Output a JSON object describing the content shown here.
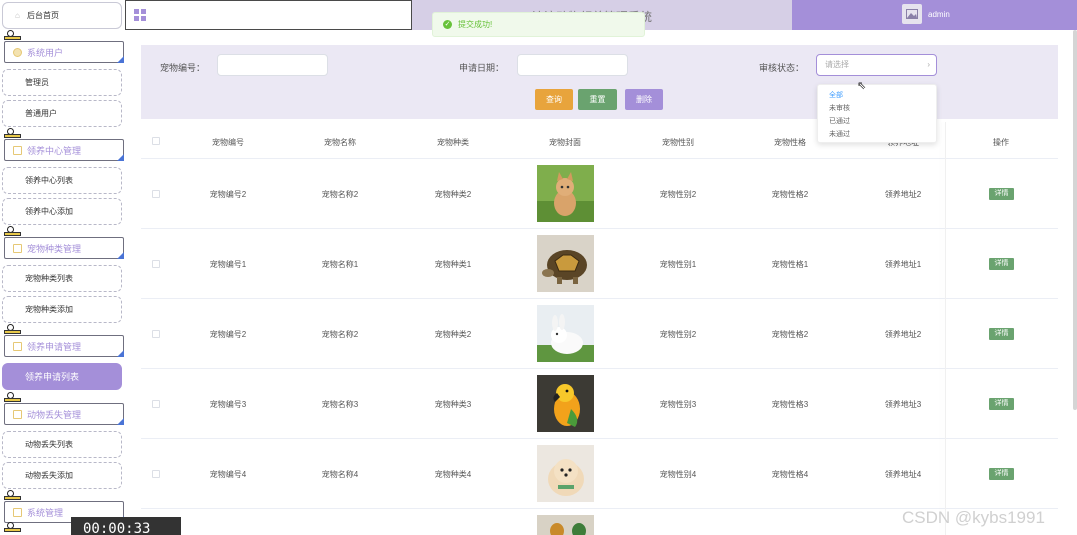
{
  "header": {
    "title": "流浪动物领养管理系统",
    "user": "admin"
  },
  "toast": {
    "message": "提交成功!"
  },
  "sidebar": {
    "home": "后台首页",
    "groups": [
      {
        "title": "系统用户",
        "items": [
          "管理员",
          "普通用户"
        ]
      },
      {
        "title": "领养中心管理",
        "items": [
          "领养中心列表",
          "领养中心添加"
        ]
      },
      {
        "title": "宠物种类管理",
        "items": [
          "宠物种类列表",
          "宠物种类添加"
        ]
      },
      {
        "title": "领养申请管理",
        "items": [
          "领养申请列表"
        ]
      },
      {
        "title": "动物丢失管理",
        "items": [
          "动物丢失列表",
          "动物丢失添加"
        ]
      },
      {
        "title": "系统管理",
        "items": []
      }
    ],
    "active_item": "领养申请列表"
  },
  "search": {
    "pet_no_label": "宠物编号：",
    "date_label": "申请日期：",
    "status_label": "审核状态：",
    "status_placeholder": "请选择",
    "status_options": [
      "全部",
      "未审核",
      "已通过",
      "未通过"
    ],
    "query": "查询",
    "reset": "重置",
    "delete": "删除"
  },
  "table": {
    "columns": [
      "宠物编号",
      "宠物名称",
      "宠物种类",
      "宠物封面",
      "宠物性别",
      "宠物性格",
      "领养地址",
      "操作"
    ],
    "detail_label": "详情",
    "rows": [
      {
        "no": "宠物编号2",
        "name": "宠物名称2",
        "kind": "宠物种类2",
        "cover": "kitten",
        "gender": "宠物性别2",
        "trait": "宠物性格2",
        "address": "领养地址2"
      },
      {
        "no": "宠物编号1",
        "name": "宠物名称1",
        "kind": "宠物种类1",
        "cover": "tortoise",
        "gender": "宠物性别1",
        "trait": "宠物性格1",
        "address": "领养地址1"
      },
      {
        "no": "宠物编号2",
        "name": "宠物名称2",
        "kind": "宠物种类2",
        "cover": "rabbit",
        "gender": "宠物性别2",
        "trait": "宠物性格2",
        "address": "领养地址2"
      },
      {
        "no": "宠物编号3",
        "name": "宠物名称3",
        "kind": "宠物种类3",
        "cover": "parrot",
        "gender": "宠物性别3",
        "trait": "宠物性格3",
        "address": "领养地址3"
      },
      {
        "no": "宠物编号4",
        "name": "宠物名称4",
        "kind": "宠物种类4",
        "cover": "pomeranian",
        "gender": "宠物性别4",
        "trait": "宠物性格4",
        "address": "领养地址4"
      }
    ]
  },
  "overlay": {
    "timer": "00:00:33",
    "watermark": "CSDN @kybs1991"
  },
  "colors": {
    "accent": "#a48fd9",
    "query": "#e8a43c",
    "reset": "#6aa36f",
    "success": "#67c23a"
  }
}
